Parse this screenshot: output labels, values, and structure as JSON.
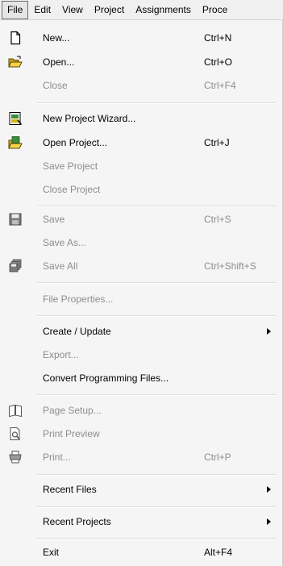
{
  "menubar": {
    "items": [
      {
        "label": "File"
      },
      {
        "label": "Edit"
      },
      {
        "label": "View"
      },
      {
        "label": "Project"
      },
      {
        "label": "Assignments"
      },
      {
        "label": "Proce"
      }
    ]
  },
  "file_menu": {
    "new": {
      "label": "New...",
      "shortcut": "Ctrl+N",
      "icon": "new-file-icon"
    },
    "open": {
      "label": "Open...",
      "shortcut": "Ctrl+O",
      "icon": "open-folder-icon"
    },
    "close": {
      "label": "Close",
      "shortcut": "Ctrl+F4"
    },
    "new_project_wizard": {
      "label": "New Project Wizard...",
      "icon": "project-wizard-icon"
    },
    "open_project": {
      "label": "Open Project...",
      "shortcut": "Ctrl+J",
      "icon": "open-project-icon"
    },
    "save_project": {
      "label": "Save Project"
    },
    "close_project": {
      "label": "Close Project"
    },
    "save": {
      "label": "Save",
      "shortcut": "Ctrl+S",
      "icon": "save-disk-icon"
    },
    "save_as": {
      "label": "Save As..."
    },
    "save_all": {
      "label": "Save All",
      "shortcut": "Ctrl+Shift+S",
      "icon": "save-all-icon"
    },
    "file_properties": {
      "label": "File Properties..."
    },
    "create_update": {
      "label": "Create / Update"
    },
    "export": {
      "label": "Export..."
    },
    "convert_programming_files": {
      "label": "Convert Programming Files..."
    },
    "page_setup": {
      "label": "Page Setup...",
      "icon": "page-setup-icon"
    },
    "print_preview": {
      "label": "Print Preview",
      "icon": "print-preview-icon"
    },
    "print": {
      "label": "Print...",
      "shortcut": "Ctrl+P",
      "icon": "printer-icon"
    },
    "recent_files": {
      "label": "Recent Files"
    },
    "recent_projects": {
      "label": "Recent Projects"
    },
    "exit": {
      "label": "Exit",
      "shortcut": "Alt+F4"
    }
  },
  "colors": {
    "menu_background": "#f5f5f5",
    "disabled_text": "#8d8d8d",
    "separator": "#dcdcdc"
  }
}
